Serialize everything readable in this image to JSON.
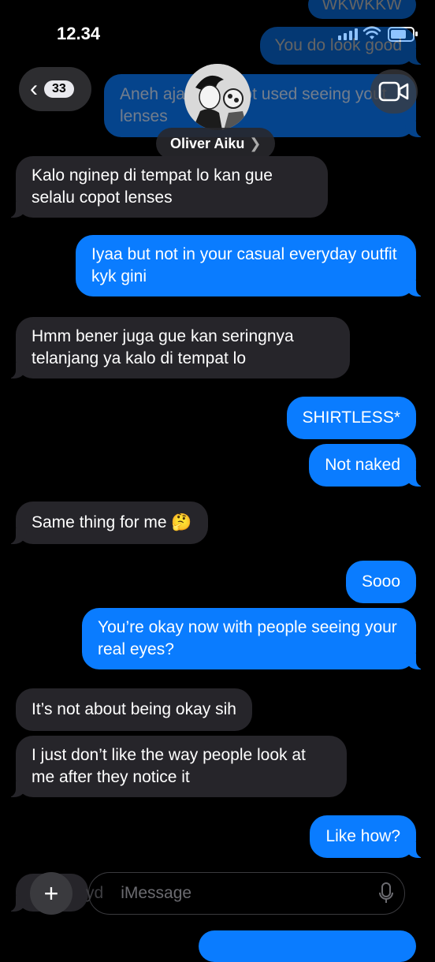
{
  "status_bar": {
    "time": "12.34"
  },
  "header": {
    "back_count": "33",
    "contact_name": "Oliver Aiku",
    "name_chevron": "❯"
  },
  "messages": [
    {
      "text": "WKWKKW",
      "from": "me"
    },
    {
      "text": "You do look good",
      "from": "me"
    },
    {
      "text": "Aneh ajase I’m not used seeing yout lenses",
      "from": "me"
    },
    {
      "text": "Kalo nginep di tempat lo kan gue selalu copot lenses",
      "from": "them"
    },
    {
      "text": "Iyaa but not in your casual everyday outfit kyk gini",
      "from": "me"
    },
    {
      "text": "Hmm bener juga gue kan seringnya telanjang ya kalo di tempat lo",
      "from": "them"
    },
    {
      "text": "SHIRTLESS*",
      "from": "me"
    },
    {
      "text": "Not naked",
      "from": "me"
    },
    {
      "text": "Same thing for me 🤔",
      "from": "them"
    },
    {
      "text": "Sooo",
      "from": "me"
    },
    {
      "text": "You’re okay now with people seeing your real eyes?",
      "from": "me"
    },
    {
      "text": "It’s not about being okay sih",
      "from": "them"
    },
    {
      "text": "I just don’t like the way people look at me after they notice it",
      "from": "them"
    },
    {
      "text": "Like how?",
      "from": "me"
    }
  ],
  "composer": {
    "placeholder": "iMessage",
    "ghost_text": "yd"
  },
  "colors": {
    "outgoing": "#0a7cff",
    "incoming": "#26252a",
    "background": "#000000"
  }
}
